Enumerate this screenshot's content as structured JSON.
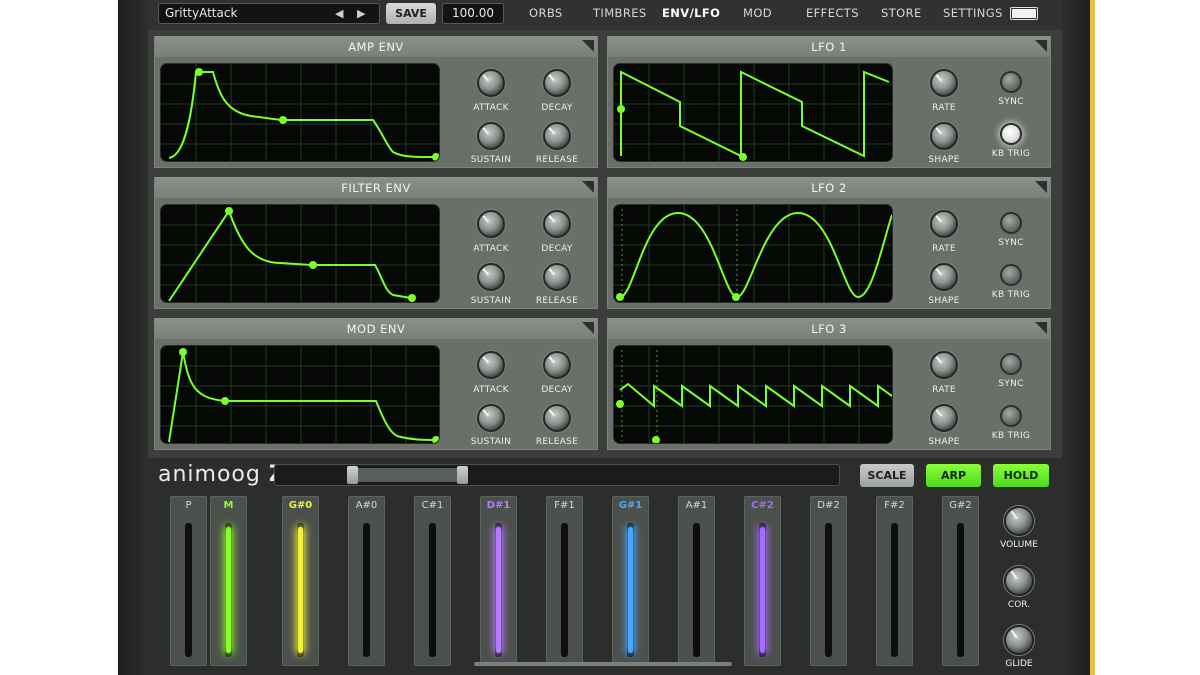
{
  "topbar": {
    "preset_name": "GrittyAttack",
    "save_label": "SAVE",
    "tempo": "100.00",
    "tabs": [
      "ORBS",
      "TIMBRES",
      "ENV/LFO",
      "MOD",
      "EFFECTS",
      "STORE",
      "SETTINGS"
    ],
    "active_tab": "ENV/LFO"
  },
  "panels": {
    "amp_env": {
      "title": "AMP ENV",
      "knobs": [
        "ATTACK",
        "DECAY",
        "SUSTAIN",
        "RELEASE"
      ]
    },
    "filter_env": {
      "title": "FILTER ENV",
      "knobs": [
        "ATTACK",
        "DECAY",
        "SUSTAIN",
        "RELEASE"
      ]
    },
    "mod_env": {
      "title": "MOD ENV",
      "knobs": [
        "ATTACK",
        "DECAY",
        "SUSTAIN",
        "RELEASE"
      ]
    },
    "lfo1": {
      "title": "LFO 1",
      "knobs": [
        "RATE",
        "SHAPE"
      ],
      "buttons": [
        "SYNC",
        "KB TRIG"
      ],
      "kbtrig_on": true
    },
    "lfo2": {
      "title": "LFO 2",
      "knobs": [
        "RATE",
        "SHAPE"
      ],
      "buttons": [
        "SYNC",
        "KB TRIG"
      ],
      "kbtrig_on": false
    },
    "lfo3": {
      "title": "LFO 3",
      "knobs": [
        "RATE",
        "SHAPE"
      ],
      "buttons": [
        "SYNC",
        "KB TRIG"
      ],
      "kbtrig_on": false
    }
  },
  "bottom": {
    "logo_text": "animoog",
    "logo_suffix": "Z",
    "scale_label": "SCALE",
    "arp_label": "ARP",
    "hold_label": "HOLD",
    "strips": [
      {
        "label": "P",
        "color": ""
      },
      {
        "label": "M",
        "color": "#8aff2a"
      },
      {
        "label": "G#0",
        "color": "#f2f23a"
      },
      {
        "label": "A#0",
        "color": ""
      },
      {
        "label": "C#1",
        "color": ""
      },
      {
        "label": "D#1",
        "color": "#b77bff"
      },
      {
        "label": "F#1",
        "color": ""
      },
      {
        "label": "G#1",
        "color": "#4aa7ff"
      },
      {
        "label": "A#1",
        "color": ""
      },
      {
        "label": "C#2",
        "color": "#a46bff"
      },
      {
        "label": "D#2",
        "color": ""
      },
      {
        "label": "F#2",
        "color": ""
      },
      {
        "label": "G#2",
        "color": ""
      }
    ],
    "knobs": [
      "VOLUME",
      "COR.",
      "GLIDE"
    ]
  },
  "colors": {
    "accent_green": "#7bff2c",
    "screen_bg": "#060806"
  }
}
